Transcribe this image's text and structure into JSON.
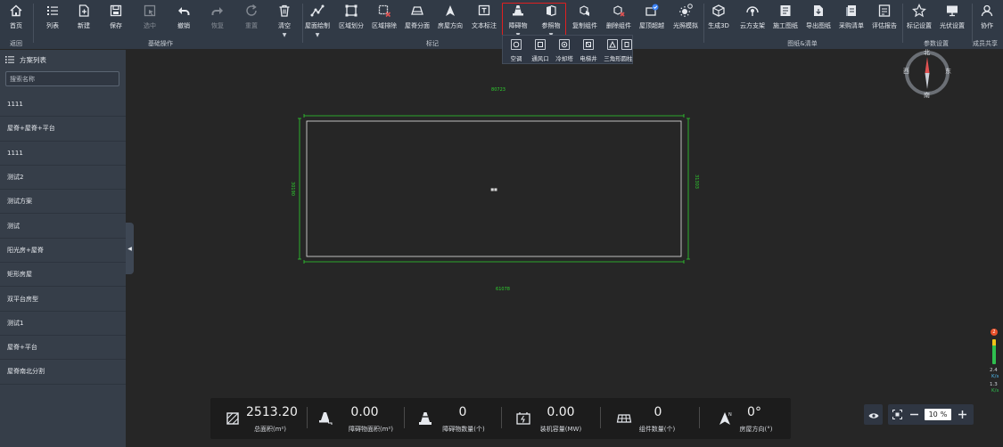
{
  "toolbar": {
    "buttons": [
      {
        "label": "首页",
        "icon": "home-icon"
      },
      {
        "label": "列表",
        "icon": "list-icon"
      },
      {
        "label": "新建",
        "icon": "new-file-icon"
      },
      {
        "label": "保存",
        "icon": "save-icon"
      },
      {
        "label": "选中",
        "icon": "select-icon"
      },
      {
        "label": "撤销",
        "icon": "undo-icon"
      },
      {
        "label": "恢复",
        "icon": "redo-icon"
      },
      {
        "label": "重置",
        "icon": "reset-icon"
      },
      {
        "label": "清空",
        "icon": "trash-icon"
      },
      {
        "label": "屋面绘制",
        "icon": "roof-draw-icon"
      },
      {
        "label": "区域划分",
        "icon": "area-divide-icon"
      },
      {
        "label": "区域排除",
        "icon": "area-exclude-icon"
      },
      {
        "label": "屋脊分面",
        "icon": "ridge-split-icon"
      },
      {
        "label": "房屋方向",
        "icon": "house-direction-icon"
      },
      {
        "label": "文本标注",
        "icon": "text-annotation-icon"
      },
      {
        "label": "障碍物",
        "icon": "obstacle-icon"
      },
      {
        "label": "参照物",
        "icon": "reference-icon"
      },
      {
        "label": "复制组件",
        "icon": "copy-component-icon"
      },
      {
        "label": "删除组件",
        "icon": "delete-component-icon"
      },
      {
        "label": "屋顶超越",
        "icon": "roof-check-icon"
      },
      {
        "label": "光照模拟",
        "icon": "sunlight-icon"
      },
      {
        "label": "生成3D",
        "icon": "cube-3d-icon"
      },
      {
        "label": "云方支架",
        "icon": "bracket-icon"
      },
      {
        "label": "施工图纸",
        "icon": "drawing-icon"
      },
      {
        "label": "导出图纸",
        "icon": "export-drawing-icon"
      },
      {
        "label": "采购清单",
        "icon": "purchase-list-icon"
      },
      {
        "label": "评估报告",
        "icon": "report-icon"
      },
      {
        "label": "标记设置",
        "icon": "pin-icon"
      },
      {
        "label": "光伏设置",
        "icon": "monitor-icon"
      },
      {
        "label": "协作",
        "icon": "user-icon"
      }
    ],
    "groups": [
      "返回",
      "基础操作",
      "标记",
      "图纸&清单",
      "参数设置",
      "成员共享"
    ]
  },
  "dropdown": {
    "items": [
      {
        "label": "空调",
        "icon": "ac-icon"
      },
      {
        "label": "通风口",
        "icon": "vent-icon"
      },
      {
        "label": "冷却塔",
        "icon": "cooling-tower-icon"
      },
      {
        "label": "电梯井",
        "icon": "elevator-icon"
      },
      {
        "label": "三角形",
        "icon": "triangle-icon"
      },
      {
        "label": "圆柱",
        "icon": "cylinder-icon"
      }
    ]
  },
  "sidebar": {
    "title": "方案列表",
    "search_placeholder": "搜索名称",
    "items": [
      "1111",
      "屋脊+屋脊+平台",
      "1111",
      "测试2",
      "测试方案",
      "测试",
      "阳光房+屋脊",
      "矩形房屋",
      "双平台房型",
      "测试1",
      "屋脊+平台",
      "屋脊南北分割"
    ]
  },
  "canvas": {
    "dim_top": "80723",
    "dim_bottom": "61078",
    "dim_left": "30190",
    "dim_right": "31303",
    "center_label": "■■"
  },
  "compass": {
    "north": "北",
    "south": "南",
    "east": "东",
    "west": "西"
  },
  "stats": [
    {
      "value": "2513.20",
      "label": "总面积(m²)",
      "icon": "area-icon"
    },
    {
      "value": "0.00",
      "label": "障碍物面积(m²)",
      "icon": "obstacle-area-icon"
    },
    {
      "value": "0",
      "label": "障碍物数量(个)",
      "icon": "obstacle-count-icon"
    },
    {
      "value": "0.00",
      "label": "装机容量(MW)",
      "icon": "capacity-icon"
    },
    {
      "value": "0",
      "label": "组件数量(个)",
      "icon": "panel-icon"
    },
    {
      "value": "0°",
      "label": "房屋方向(°)",
      "icon": "direction-icon"
    }
  ],
  "zoom": {
    "value": "10",
    "unit": "%"
  },
  "network": {
    "badge": "2",
    "up": "2.4",
    "up_unit": "K/s",
    "down": "1.3",
    "down_unit": "K/s"
  },
  "colors": {
    "toolbar": "#313a46",
    "canvas": "#262626",
    "sidebar": "#363e49",
    "accent": "#e02020",
    "outline_green": "#2fd12f"
  }
}
